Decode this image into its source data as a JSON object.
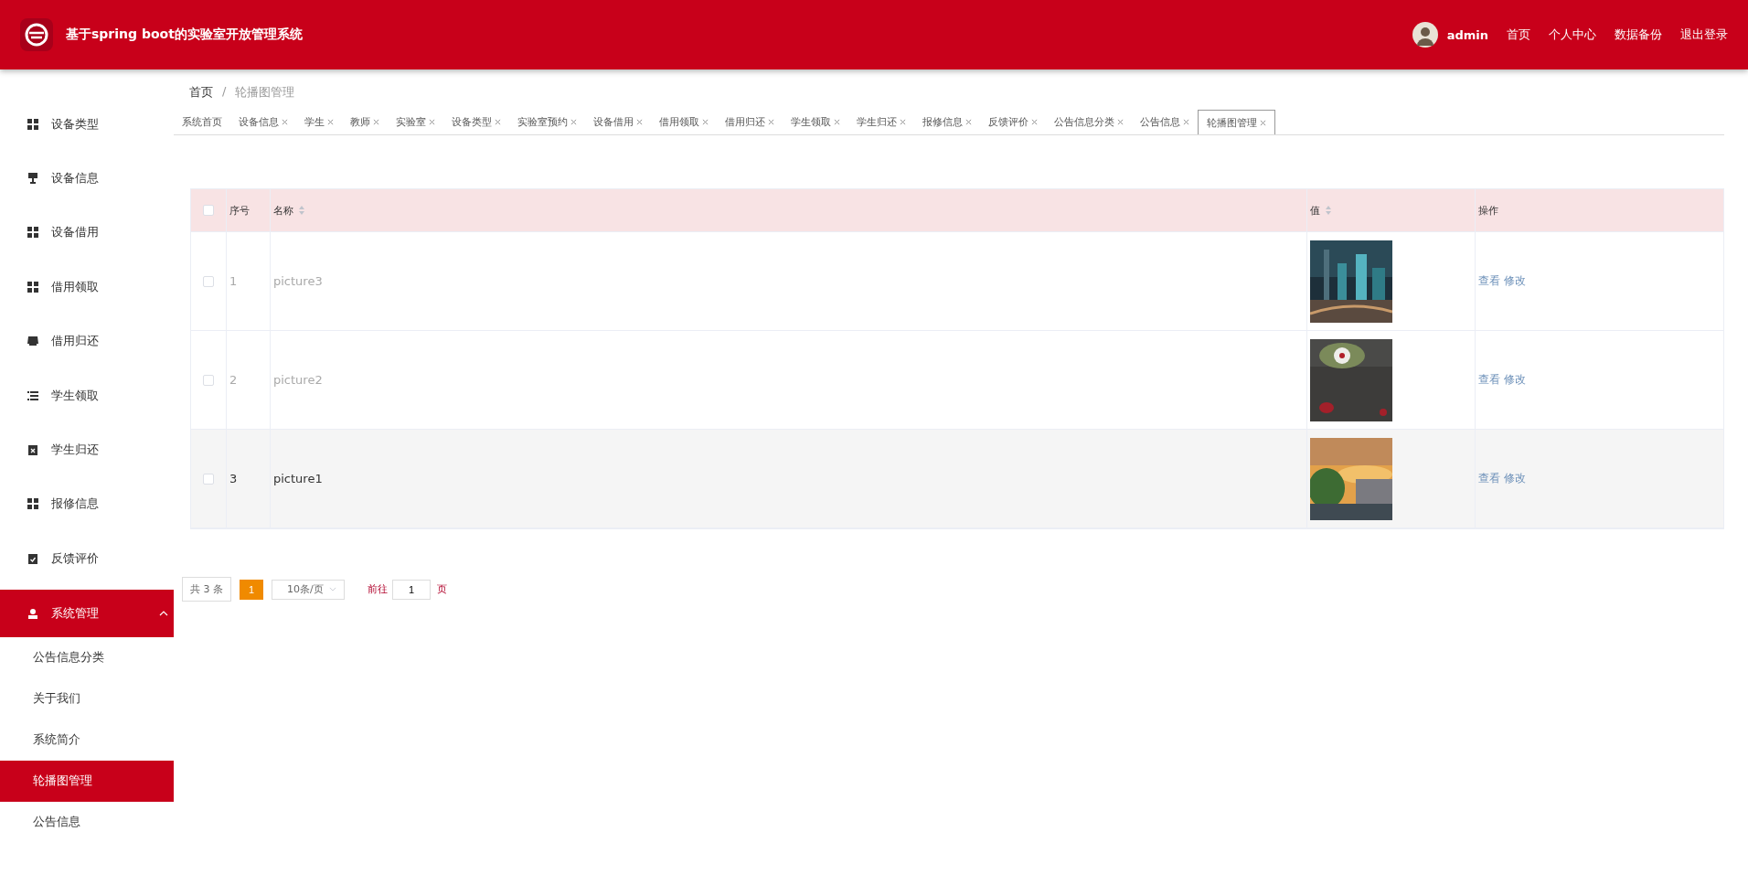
{
  "header": {
    "title": "基于spring boot的实验室开放管理系统",
    "user": "admin",
    "links": [
      "首页",
      "个人中心",
      "数据备份",
      "退出登录"
    ]
  },
  "sidebar": {
    "items": [
      {
        "label": "设备类型"
      },
      {
        "label": "设备信息"
      },
      {
        "label": "设备借用"
      },
      {
        "label": "借用领取"
      },
      {
        "label": "借用归还"
      },
      {
        "label": "学生领取"
      },
      {
        "label": "学生归还"
      },
      {
        "label": "报修信息"
      },
      {
        "label": "反馈评价"
      }
    ],
    "group": {
      "label": "系统管理",
      "expanded": true,
      "children": [
        {
          "label": "公告信息分类",
          "selected": false
        },
        {
          "label": "关于我们",
          "selected": false
        },
        {
          "label": "系统简介",
          "selected": false
        },
        {
          "label": "轮播图管理",
          "selected": true
        },
        {
          "label": "公告信息",
          "selected": false
        }
      ]
    }
  },
  "breadcrumb": [
    "首页",
    "/",
    "轮播图管理"
  ],
  "tabs": [
    {
      "label": "系统首页",
      "closable": false,
      "selected": false
    },
    {
      "label": "设备信息",
      "closable": true,
      "selected": false
    },
    {
      "label": "学生",
      "closable": true,
      "selected": false
    },
    {
      "label": "教师",
      "closable": true,
      "selected": false
    },
    {
      "label": "实验室",
      "closable": true,
      "selected": false
    },
    {
      "label": "设备类型",
      "closable": true,
      "selected": false
    },
    {
      "label": "实验室预约",
      "closable": true,
      "selected": false
    },
    {
      "label": "设备借用",
      "closable": true,
      "selected": false
    },
    {
      "label": "借用领取",
      "closable": true,
      "selected": false
    },
    {
      "label": "借用归还",
      "closable": true,
      "selected": false
    },
    {
      "label": "学生领取",
      "closable": true,
      "selected": false
    },
    {
      "label": "学生归还",
      "closable": true,
      "selected": false
    },
    {
      "label": "报修信息",
      "closable": true,
      "selected": false
    },
    {
      "label": "反馈评价",
      "closable": true,
      "selected": false
    },
    {
      "label": "公告信息分类",
      "closable": true,
      "selected": false
    },
    {
      "label": "公告信息",
      "closable": true,
      "selected": false
    },
    {
      "label": "轮播图管理",
      "closable": true,
      "selected": true
    }
  ],
  "table": {
    "all_checked": false,
    "columns": [
      {
        "label": "序号",
        "sortable": false
      },
      {
        "label": "名称",
        "sortable": true
      },
      {
        "label": "值",
        "sortable": true
      },
      {
        "label": "操作",
        "sortable": false
      }
    ],
    "rows": [
      {
        "index": "1",
        "name": "picture3",
        "checked": false,
        "hovered": false,
        "actions": [
          "查看",
          "修改"
        ]
      },
      {
        "index": "2",
        "name": "picture2",
        "checked": false,
        "hovered": false,
        "actions": [
          "查看",
          "修改"
        ]
      },
      {
        "index": "3",
        "name": "picture1",
        "checked": false,
        "hovered": true,
        "actions": [
          "查看",
          "修改"
        ]
      }
    ]
  },
  "pagination": {
    "total": "共 3 条",
    "pages": [
      {
        "label": "1",
        "selected": true
      }
    ],
    "page_size": "10条/页",
    "goto_label": "前往",
    "goto_value": "1",
    "goto_suffix": "页"
  }
}
